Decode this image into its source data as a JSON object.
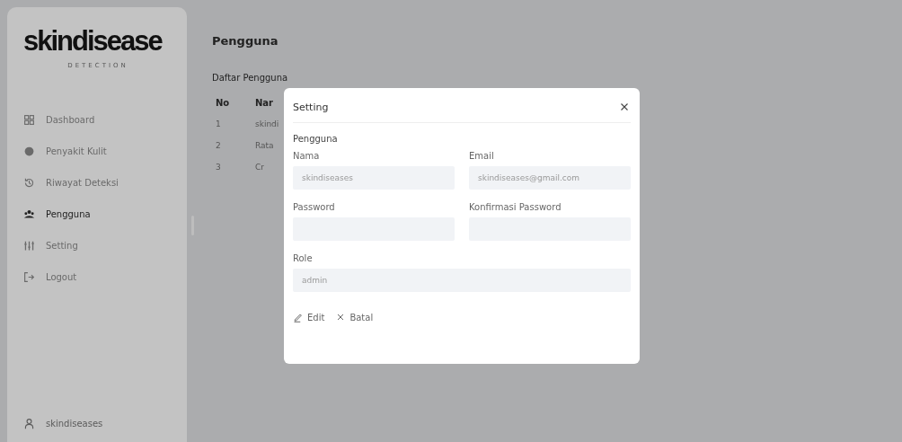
{
  "sidebar": {
    "logo": "skindisease",
    "tagline": "DETECTION",
    "items": [
      {
        "label": "Dashboard",
        "selected": false
      },
      {
        "label": "Penyakit Kulit",
        "selected": false
      },
      {
        "label": "Riwayat Deteksi",
        "selected": false
      },
      {
        "label": "Pengguna",
        "selected": true
      },
      {
        "label": "Setting",
        "selected": false
      },
      {
        "label": "Logout",
        "selected": false
      }
    ],
    "user": "skindiseases"
  },
  "page_title": "Pengguna",
  "table": {
    "title": "Daftar Pengguna",
    "columns": [
      "No",
      "Nar"
    ],
    "rows": [
      [
        "1",
        "skindi"
      ],
      [
        "2",
        "Rata"
      ],
      [
        "3",
        "Cr"
      ]
    ]
  },
  "dialog": {
    "title": "Setting",
    "section": "Pengguna",
    "fields": [
      {
        "label": "Nama",
        "value": "skindiseases"
      },
      {
        "label": "Email",
        "value": "skindiseases@gmail.com"
      },
      {
        "label": "Password"
      },
      {
        "label": "Konfirmasi Password"
      },
      {
        "label": "Role",
        "value": "admin"
      }
    ],
    "actions": [
      {
        "label": "Edit"
      },
      {
        "label": "Batal"
      }
    ]
  }
}
